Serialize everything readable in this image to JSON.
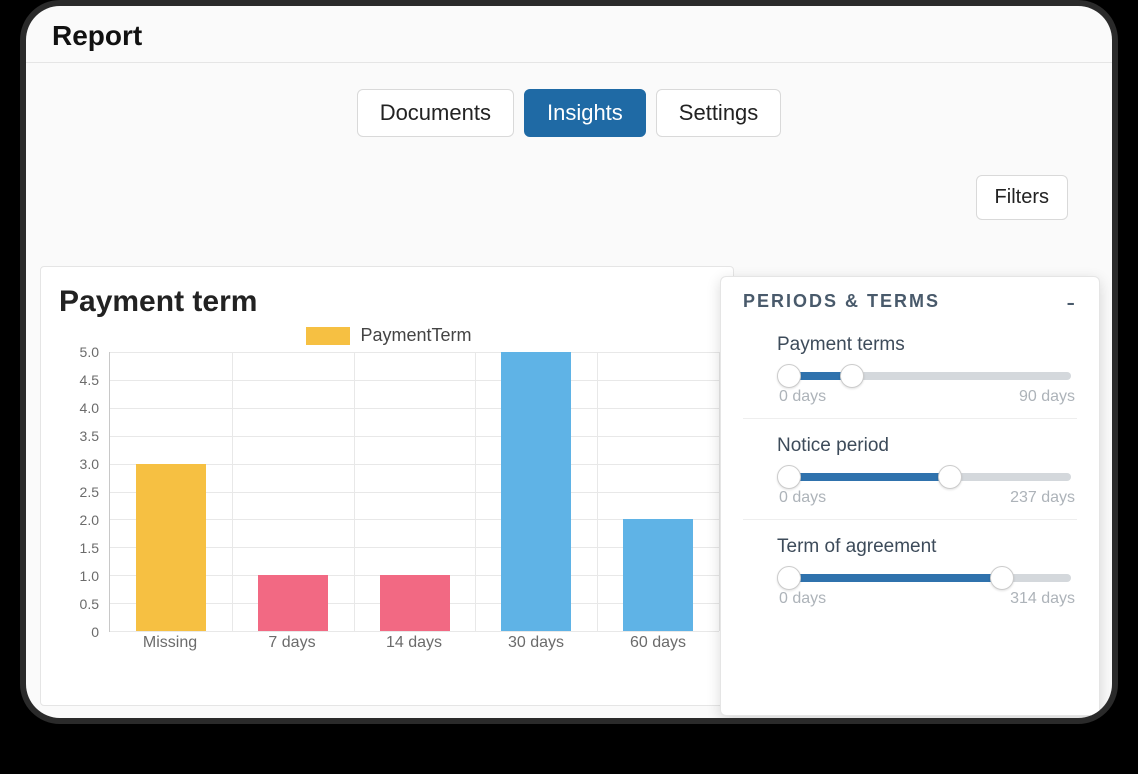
{
  "page_title": "Report",
  "tabs": [
    {
      "label": "Documents",
      "active": false
    },
    {
      "label": "Insights",
      "active": true
    },
    {
      "label": "Settings",
      "active": false
    }
  ],
  "filters_button": "Filters",
  "chart": {
    "title": "Payment term",
    "legend": "PaymentTerm"
  },
  "chart_data": {
    "type": "bar",
    "title": "Payment term",
    "series_name": "PaymentTerm",
    "categories": [
      "Missing",
      "7 days",
      "14 days",
      "30 days",
      "60 days"
    ],
    "values": [
      3,
      1,
      1,
      5,
      2
    ],
    "colors": [
      "#f6c042",
      "#f26983",
      "#f26983",
      "#5fb3e6",
      "#5fb3e6"
    ],
    "ylim": [
      0,
      5
    ],
    "y_ticks": [
      0,
      0.5,
      1.0,
      1.5,
      2.0,
      2.5,
      3.0,
      3.5,
      4.0,
      4.5,
      5.0
    ],
    "xlabel": "",
    "ylabel": ""
  },
  "panel": {
    "title": "Periods & Terms",
    "collapse": "-",
    "sliders": [
      {
        "label": "Payment terms",
        "min_label": "0 days",
        "max_label": "90 days",
        "lo_pct": 2,
        "hi_pct": 24
      },
      {
        "label": "Notice period",
        "min_label": "0 days",
        "max_label": "237 days",
        "lo_pct": 2,
        "hi_pct": 58
      },
      {
        "label": "Term of agreement",
        "min_label": "0 days",
        "max_label": "314 days",
        "lo_pct": 2,
        "hi_pct": 76
      }
    ]
  }
}
